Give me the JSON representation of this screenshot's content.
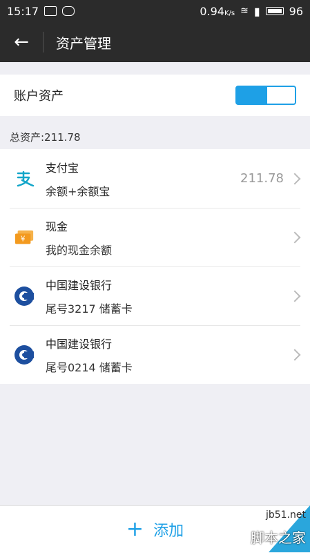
{
  "status": {
    "time": "15:17",
    "speed": "0.94",
    "speed_unit": "K/s",
    "battery": "96"
  },
  "header": {
    "title": "资产管理"
  },
  "account_assets": {
    "label": "账户资产"
  },
  "total": {
    "label": "总资产:211.78"
  },
  "accounts": [
    {
      "name": "支付宝",
      "sub": "余额+余额宝",
      "amount": "211.78",
      "icon": "alipay-icon"
    },
    {
      "name": "现金",
      "sub": "我的现金余额",
      "amount": "",
      "icon": "cash-icon"
    },
    {
      "name": "中国建设银行",
      "sub": "尾号3217 储蓄卡",
      "amount": "",
      "icon": "ccb-icon"
    },
    {
      "name": "中国建设银行",
      "sub": "尾号0214 储蓄卡",
      "amount": "",
      "icon": "ccb-icon"
    }
  ],
  "bottom": {
    "add_label": "添加"
  },
  "watermark": {
    "top": "jb51.net",
    "bottom": "脚本之家"
  },
  "colors": {
    "accent": "#1ea0e6",
    "appbar": "#2b2b2b"
  }
}
